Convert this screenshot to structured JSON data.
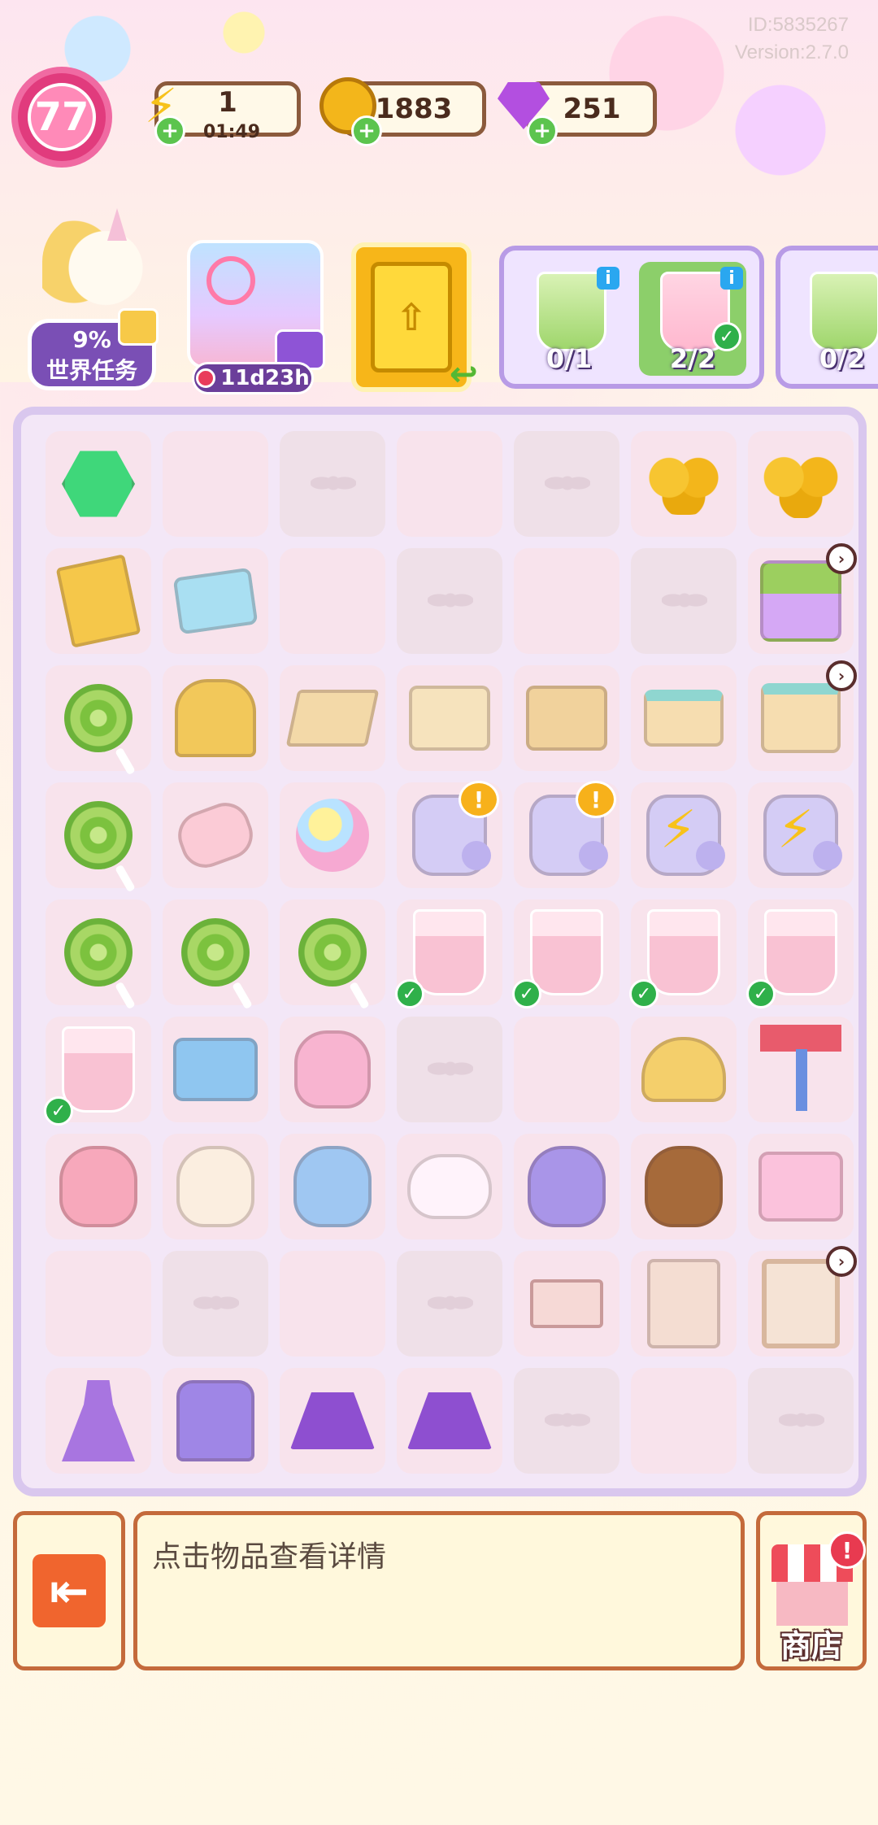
{
  "header": {
    "id_text": "ID:5835267",
    "version_text": "Version:2.7.0",
    "level": "77",
    "energy": "1",
    "energy_timer": "01:49",
    "coins": "1883",
    "gems": "251"
  },
  "world_task": {
    "percent": "9%",
    "label": "世界任务"
  },
  "event": {
    "timer": "11d23h"
  },
  "orders": [
    {
      "progress": "0/1",
      "flavor": "green",
      "done": false
    },
    {
      "progress": "2/2",
      "flavor": "pink",
      "done": true
    },
    {
      "progress": "0/2",
      "flavor": "green",
      "done": false
    }
  ],
  "board": {
    "rows": [
      [
        "infinity-hex",
        "empty",
        "locked",
        "empty",
        "locked",
        "coin-small",
        "coin-big"
      ],
      [
        "storybook",
        "tickets",
        "empty",
        "locked",
        "empty",
        "locked",
        "toy-house"
      ],
      [
        "lollipop",
        "gate",
        "box-open",
        "box-closed",
        "box-half",
        "gift-box-small",
        "gift-box"
      ],
      [
        "lollipop",
        "marshmallow",
        "cotton-candy",
        "jar",
        "jar",
        "jar-energy",
        "jar-energy"
      ],
      [
        "lollipop",
        "lollipop",
        "lollipop",
        "milkshake",
        "milkshake",
        "milkshake",
        "milkshake"
      ],
      [
        "milkshake",
        "candy-tray",
        "candy-bag",
        "locked",
        "empty",
        "teacup-ride",
        "swing-ride"
      ],
      [
        "bunny-plush",
        "puppy-plush",
        "cat-plush",
        "unicorn-plush",
        "purple-bear",
        "brown-bear",
        "pink-bed"
      ],
      [
        "empty",
        "locked",
        "empty",
        "locked",
        "drawer",
        "cabinet",
        "wardrobe"
      ],
      [
        "purple-dress",
        "purple-coat",
        "purple-skirt",
        "purple-skirt",
        "locked",
        "empty",
        "locked"
      ]
    ]
  },
  "bottom": {
    "hint": "点击物品查看详情",
    "shop_label": "商店"
  },
  "colors": {
    "accent_purple": "#b89be6",
    "wood_brown": "#c46a3b",
    "check_green": "#2fb04a"
  }
}
